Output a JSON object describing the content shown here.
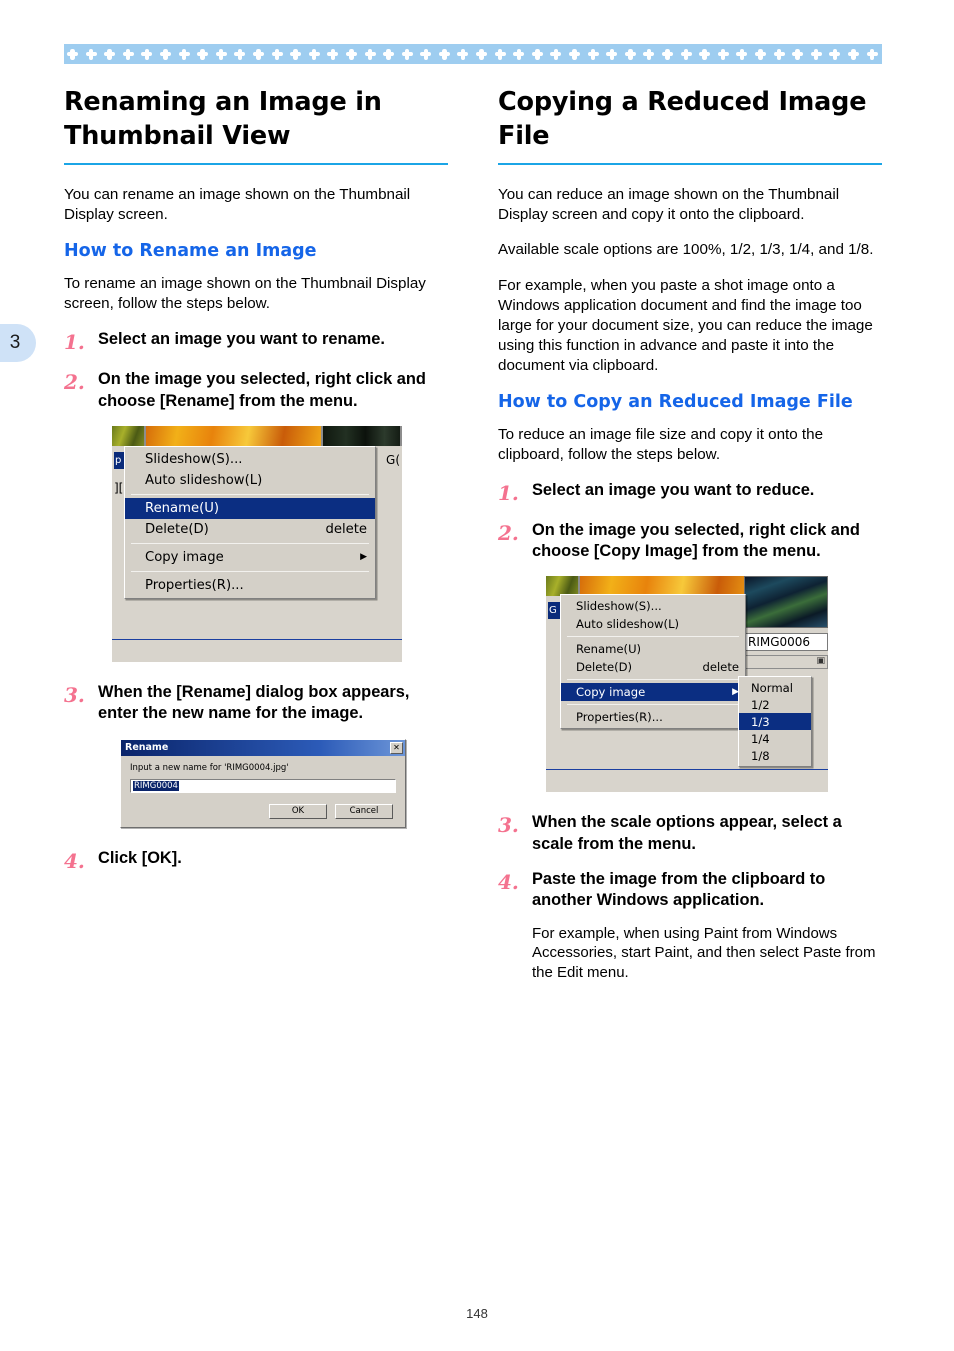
{
  "decoration": {
    "band_color": "#9ecdf0",
    "motif_color": "#ffffff",
    "motif_name": "clover-diamond",
    "motif_count": 47
  },
  "chapter_tab": {
    "number": "3",
    "background_color": "#cfe2f7"
  },
  "page_number": "148",
  "colors": {
    "heading_rule": "#1ba5e6",
    "sub_heading": "#1565e8",
    "step_number": "#f4728f",
    "menu_highlight": "#0b2e82"
  },
  "left_column": {
    "title": "Renaming an Image in Thumbnail View",
    "intro": "You can rename an image shown on the Thumbnail Display screen.",
    "sub_heading": "How to Rename an Image",
    "lead": "To rename an image shown on the Thumbnail Display screen, follow the steps below.",
    "steps": [
      {
        "num": "1.",
        "text": "Select an image you want to rename."
      },
      {
        "num": "2.",
        "text": "On the image you selected, right click and choose [Rename] from the menu."
      },
      {
        "num": "3.",
        "text": "When the [Rename] dialog box appears, enter the new name for the image."
      },
      {
        "num": "4.",
        "text": "Click [OK]."
      }
    ]
  },
  "right_column": {
    "title": "Copying a Reduced Image File",
    "intro": "You can reduce an image shown on the Thumbnail Display screen and copy it onto the clipboard.",
    "scale_note": "Available scale options are 100%, 1/2, 1/3, 1/4, and 1/8.",
    "example": "For example, when you paste a shot image onto a Windows application document and find the image too large for your document size, you can reduce the image using this function in advance and paste it into the document via clipboard.",
    "sub_heading": "How to Copy an Reduced Image File",
    "lead": "To reduce an image file size and copy it onto the clipboard, follow the steps below.",
    "steps": [
      {
        "num": "1.",
        "text": "Select an image you want to reduce."
      },
      {
        "num": "2.",
        "text": "On the image you selected, right click and choose [Copy Image] from the menu."
      },
      {
        "num": "3.",
        "text": "When the scale options appear, select a scale from the menu."
      },
      {
        "num": "4.",
        "text": "Paste the image from the clipboard to another Windows application."
      }
    ],
    "step4_note": "For example, when using Paint from Windows Accessories, start Paint, and then select Paste from the Edit menu."
  },
  "screenshot_context_menu_left": {
    "items": [
      {
        "label": "Slideshow(S)...",
        "accel": "",
        "selected": false,
        "submenu": false
      },
      {
        "label": "Auto slideshow(L)",
        "accel": "",
        "selected": false,
        "submenu": false
      },
      {
        "label": "Rename(U)",
        "accel": "",
        "selected": true,
        "submenu": false
      },
      {
        "label": "Delete(D)",
        "accel": "delete",
        "selected": false,
        "submenu": false
      },
      {
        "label": "Copy image",
        "accel": "",
        "selected": false,
        "submenu": true
      },
      {
        "label": "Properties(R)...",
        "accel": "",
        "selected": false,
        "submenu": false
      }
    ],
    "side_selected_text": "p",
    "side_text": "][",
    "right_text": "G("
  },
  "screenshot_context_menu_right": {
    "items": [
      {
        "label": "Slideshow(S)...",
        "accel": "",
        "selected": false,
        "submenu": false
      },
      {
        "label": "Auto slideshow(L)",
        "accel": "",
        "selected": false,
        "submenu": false
      },
      {
        "label": "Rename(U)",
        "accel": "",
        "selected": false,
        "submenu": false
      },
      {
        "label": "Delete(D)",
        "accel": "delete",
        "selected": false,
        "submenu": false
      },
      {
        "label": "Copy image",
        "accel": "",
        "selected": true,
        "submenu": true
      },
      {
        "label": "Properties(R)...",
        "accel": "",
        "selected": false,
        "submenu": false
      }
    ],
    "submenu_items": [
      {
        "label": "Normal",
        "selected": false
      },
      {
        "label": "1/2",
        "selected": false
      },
      {
        "label": "1/3",
        "selected": true
      },
      {
        "label": "1/4",
        "selected": false
      },
      {
        "label": "1/8",
        "selected": false
      }
    ],
    "thumbnail_filename": "RIMG0006",
    "side_selected_text": "G",
    "submenu_arrow": "▶"
  },
  "rename_dialog": {
    "title": "Rename",
    "close_label": "✕",
    "prompt": "Input a new name for 'RIMG0004.jpg'",
    "input_value": "RIMG0004",
    "ok_label": "OK",
    "cancel_label": "Cancel"
  }
}
